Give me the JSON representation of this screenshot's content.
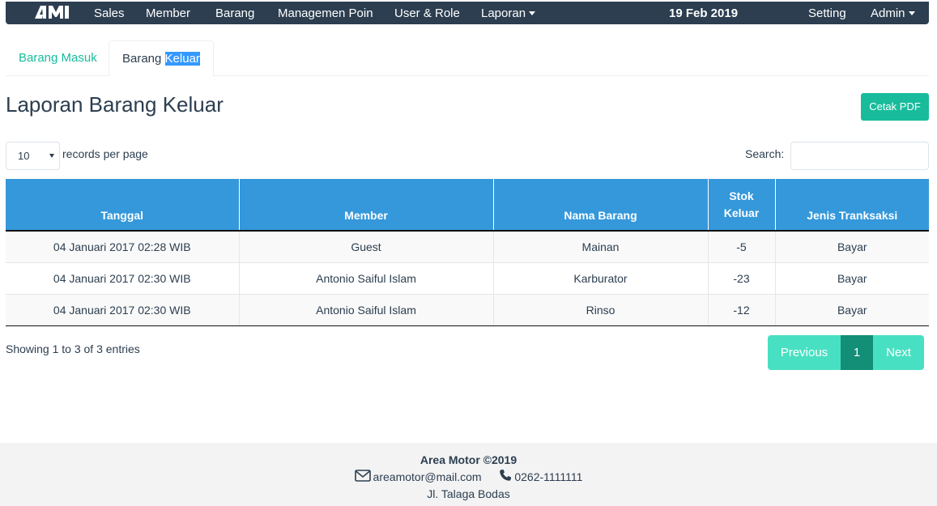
{
  "nav": {
    "items": [
      "Sales",
      "Member",
      "Barang",
      "Managemen Poin",
      "User & Role",
      "Laporan"
    ],
    "date": "19 Feb 2019",
    "setting": "Setting",
    "admin": "Admin"
  },
  "tabs": {
    "masuk": "Barang Masuk",
    "keluar_prefix": "Barang ",
    "keluar_highlight": "Keluar"
  },
  "page": {
    "title": "Laporan Barang Keluar",
    "pdf_button": "Cetak PDF"
  },
  "controls": {
    "page_length": "10",
    "records_label": "records per page",
    "search_label": "Search:",
    "search_value": ""
  },
  "table": {
    "headers": [
      "Tanggal",
      "Member",
      "Nama Barang",
      "Stok Keluar",
      "Jenis Tranksaksi"
    ],
    "rows": [
      [
        "04 Januari 2017 02:28 WIB",
        "Guest",
        "Mainan",
        "-5",
        "Bayar"
      ],
      [
        "04 Januari 2017 02:30 WIB",
        "Antonio Saiful Islam",
        "Karburator",
        "-23",
        "Bayar"
      ],
      [
        "04 Januari 2017 02:30 WIB",
        "Antonio Saiful Islam",
        "Rinso",
        "-12",
        "Bayar"
      ]
    ]
  },
  "footer_info": "Showing 1 to 3 of 3 entries",
  "pagination": {
    "previous": "Previous",
    "current": "1",
    "next": "Next"
  },
  "footer": {
    "brand": "Area Motor ©2019",
    "email": "areamotor@mail.com",
    "phone": "0262-1111111",
    "address": "Jl. Talaga Bodas"
  },
  "colors": {
    "navbar": "#2c3e50",
    "accent": "#18bc9c",
    "table_header": "#3498db",
    "pager": "#48e0c2",
    "pager_active": "#128f76"
  }
}
